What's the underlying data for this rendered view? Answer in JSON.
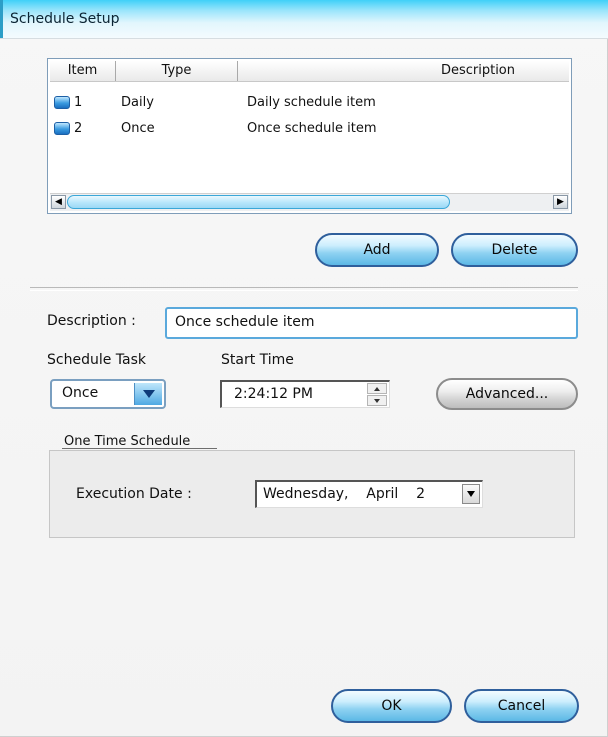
{
  "window": {
    "title": "Schedule Setup"
  },
  "list": {
    "columns": [
      "Item",
      "Type",
      "Description"
    ],
    "rows": [
      {
        "item": "1",
        "type": "Daily",
        "description": "Daily schedule item"
      },
      {
        "item": "2",
        "type": "Once",
        "description": "Once schedule item"
      }
    ]
  },
  "buttons": {
    "add": "Add",
    "delete": "Delete",
    "advanced": "Advanced...",
    "ok": "OK",
    "cancel": "Cancel"
  },
  "form": {
    "description_label": "Description :",
    "description_value": "Once schedule item",
    "schedule_task_label": "Schedule Task",
    "schedule_task_value": "Once",
    "start_time_label": "Start Time",
    "start_time_value": "2:24:12 PM"
  },
  "one_time": {
    "group_title": "One Time Schedule",
    "execution_date_label": "Execution Date :",
    "execution_date_value": "Wednesday,    April    2"
  },
  "icons": {
    "row_icon": "schedule-item-icon",
    "scroll_left": "arrow-left-icon",
    "scroll_right": "arrow-right-icon",
    "dropdown": "chevron-down-icon"
  },
  "colors": {
    "title_gradient": "#3fd0f8",
    "button_blue": "#5cb8e6",
    "border_blue": "#2f5f9c"
  }
}
